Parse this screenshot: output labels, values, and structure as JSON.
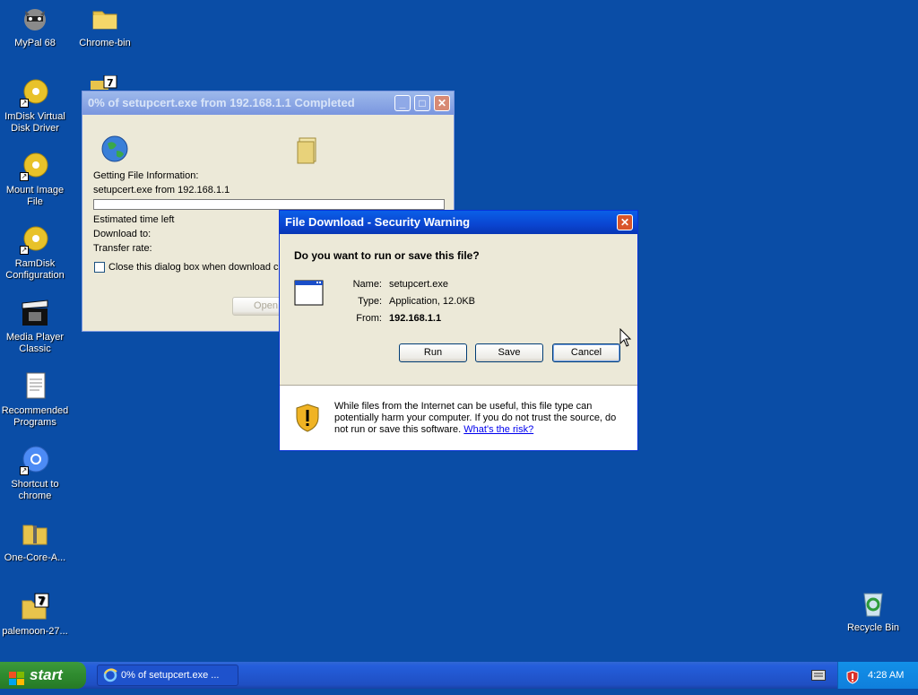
{
  "desktop": {
    "icons": [
      {
        "label": "MyPal 68"
      },
      {
        "label": "Chrome-bin"
      },
      {
        "label": "ImDisk Virtual Disk Driver"
      },
      {
        "label": "Mount Image File"
      },
      {
        "label": "RamDisk Configuration"
      },
      {
        "label": "Media Player Classic"
      },
      {
        "label": "Recommended Programs"
      },
      {
        "label": "Shortcut to chrome"
      },
      {
        "label": "One-Core-A..."
      },
      {
        "label": "palemoon-27..."
      },
      {
        "label": "Recycle Bin"
      }
    ]
  },
  "progress_window": {
    "title": "0% of setupcert.exe from 192.168.1.1 Completed",
    "getting_info": "Getting File Information:",
    "file_source": "setupcert.exe from 192.168.1.1",
    "progress_percent": 0,
    "estimated_time_label": "Estimated time left",
    "download_to_label": "Download to:",
    "transfer_rate_label": "Transfer rate:",
    "close_checkbox_label": "Close this dialog box when download co",
    "open_button": "Open"
  },
  "security_dialog": {
    "title": "File Download - Security Warning",
    "question": "Do you want to run or save this file?",
    "name_label": "Name:",
    "name_value": "setupcert.exe",
    "type_label": "Type:",
    "type_value": "Application, 12.0KB",
    "from_label": "From:",
    "from_value": "192.168.1.1",
    "run_button": "Run",
    "save_button": "Save",
    "cancel_button": "Cancel",
    "warning_text": "While files from the Internet can be useful, this file type can potentially harm your computer. If you do not trust the source, do not run or save this software.",
    "risk_link": "What's the risk?"
  },
  "taskbar": {
    "start_label": "start",
    "task_label": "0% of setupcert.exe ...",
    "clock": "4:28 AM"
  },
  "colors": {
    "desktop_bg": "#0a4da6",
    "title_active": "#0a45d1",
    "dialog_bg": "#ece9d8",
    "link": "#0000ee"
  }
}
